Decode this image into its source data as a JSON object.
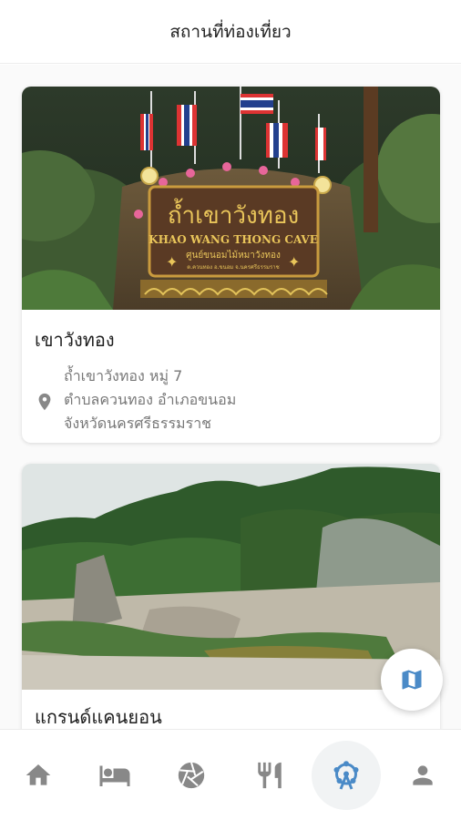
{
  "header": {
    "title": "สถานที่ท่องเที่ยว"
  },
  "places": [
    {
      "title": "เขาวังทอง",
      "address": [
        "ถ้ำเขาวังทอง หมู่ 7",
        "ตำบลควนทอง อำเภอขนอม",
        "จังหวัดนครศรีธรรมราช"
      ],
      "sign": {
        "thai": "ถ้ำเขาวังทอง",
        "english": "KHAO WANG THONG CAVE",
        "sub": "ศูนย์ขนอมไม้หมาวังทอง",
        "small": "ต.ควนทอง อ.ขนอม จ.นครศรีธรรมราช"
      }
    },
    {
      "title": "แกรนด์แคนยอน"
    }
  ],
  "fab": {
    "icon": "map-icon"
  },
  "bottom_nav": {
    "items": [
      "home-icon",
      "bed-icon",
      "camera-aperture-icon",
      "restaurant-icon",
      "ferris-wheel-icon",
      "person-icon"
    ],
    "active_index": 4
  },
  "colors": {
    "accent": "#4a8ac7",
    "icon": "#888888",
    "card_text": "#1e1e1e"
  }
}
